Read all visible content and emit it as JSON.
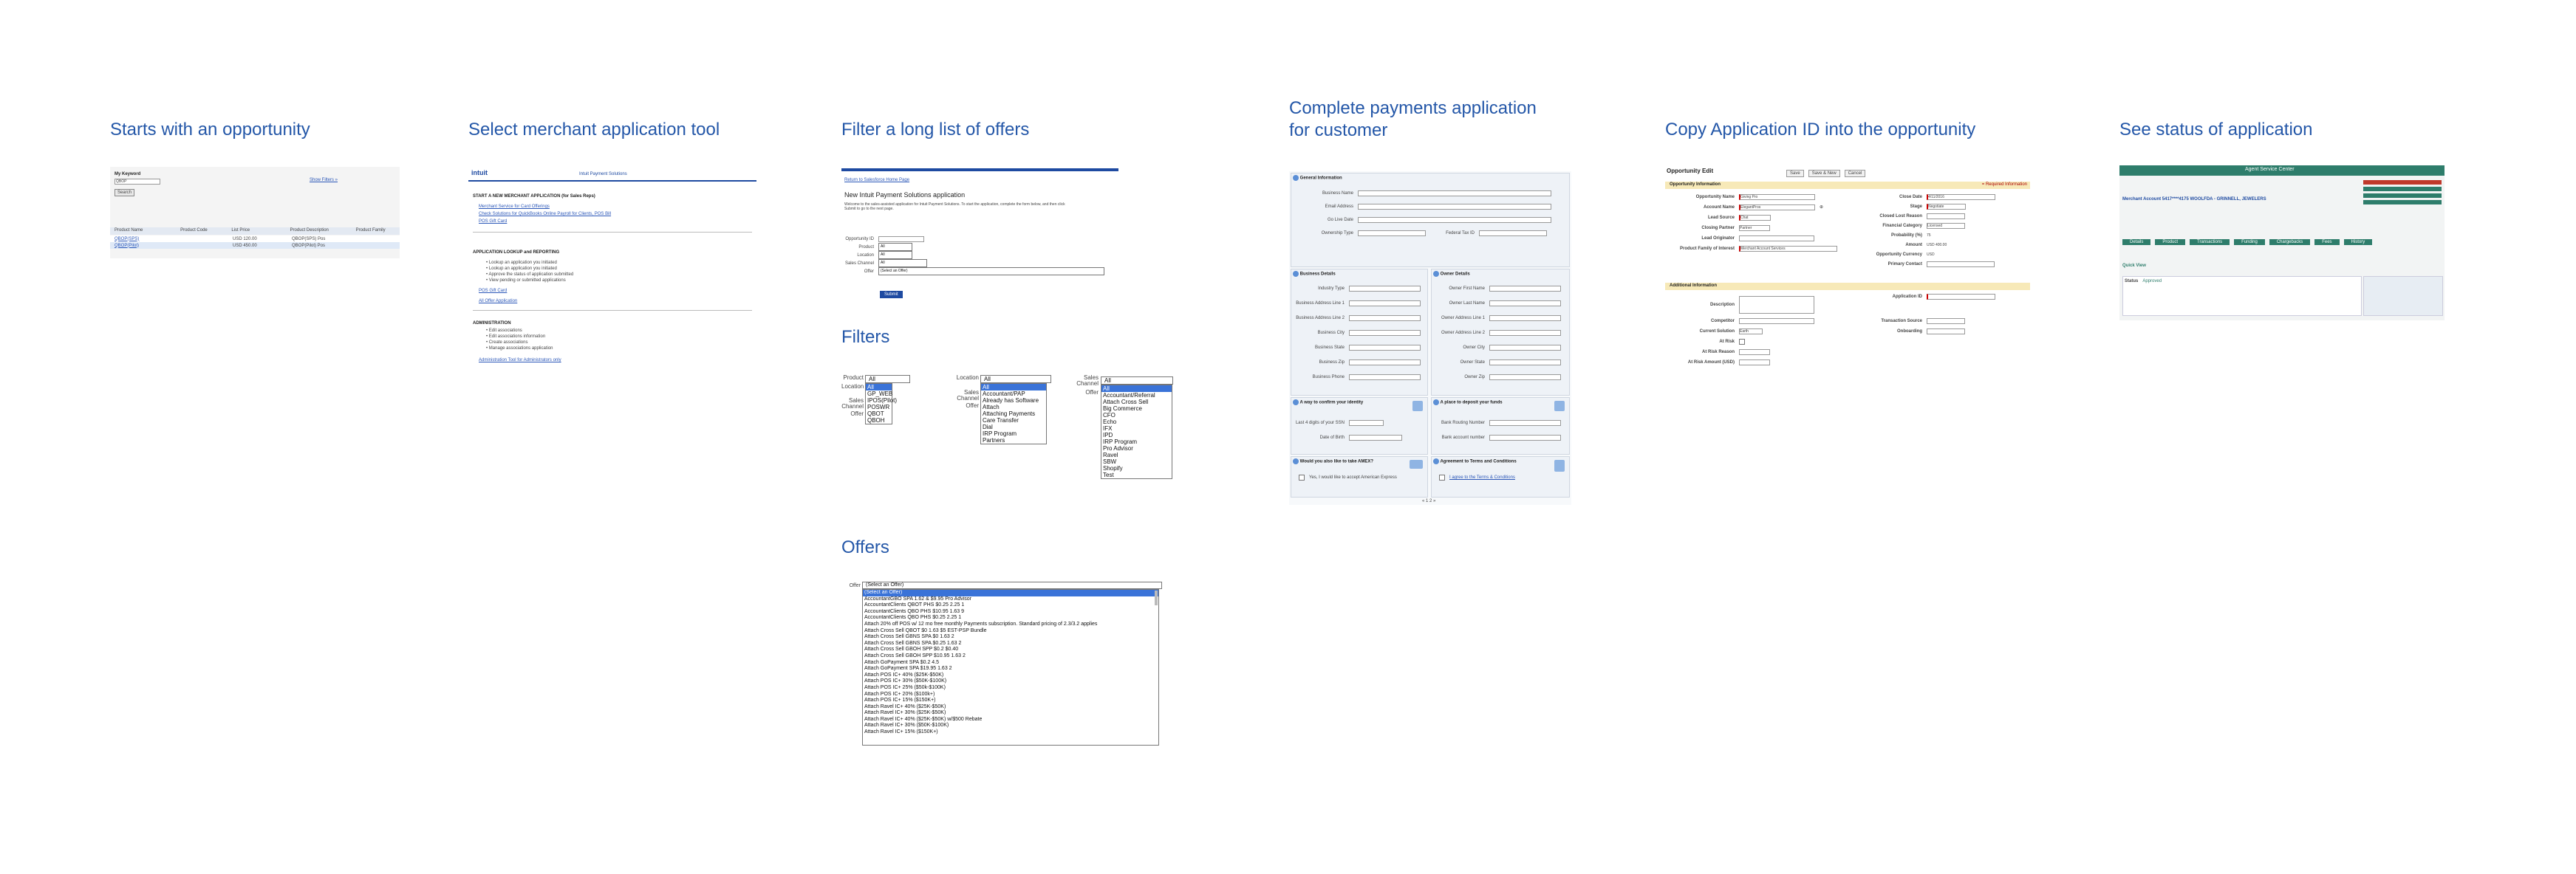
{
  "titles": {
    "t1": "Starts with an opportunity",
    "t2": "Select merchant application tool",
    "t3": "Filter a long list of offers",
    "t4_line1": "Complete payments application",
    "t4_line2": "for customer",
    "t5": "Copy Application ID into the opportunity",
    "t6": "See status of application",
    "filters": "Filters",
    "offers": "Offers"
  },
  "shot1": {
    "keyword_label": "My Keyword",
    "keyword_value": "QBOP",
    "search_btn": "Search",
    "advanced": "Show Filters »",
    "table_headers": [
      "Product Name",
      "Product Code",
      "List Price",
      "Product Description",
      "Product Family"
    ],
    "rows": [
      [
        "QBOP(SPS)",
        "",
        "USD 120.00",
        "QBOP(SPS) Pos",
        ""
      ],
      [
        "QBOP(Pilot)",
        "",
        "USD 450.00",
        "QBOP(Pilot) Pos",
        ""
      ]
    ]
  },
  "shot2": {
    "logo": "intuit",
    "brand": "Intuit Payment Solutions",
    "sec1": "START A NEW MERCHANT APPLICATION (for Sales Reps)",
    "links1": [
      "Merchant Service for Card Offerings",
      "Check Solutions for QuickBooks Online Payroll for Clients, POS Bill",
      "POS Gift Card"
    ],
    "sec2": "APPLICATION LOOKUP and REPORTING",
    "bullets2": [
      "Lookup an application you initiated",
      "Lookup an application you initiated",
      "Approve the status of application submitted",
      "View pending or submitted applications"
    ],
    "links2": [
      "POS Gift Card",
      "All Offer Application"
    ],
    "sec3": "ADMINISTRATION",
    "bullets3": [
      "Edit associations",
      "Edit associations information",
      "Create associations",
      "Manage associations application"
    ],
    "link3": "Administration Tool for Administrators only"
  },
  "shot3": {
    "back": "Return to Salesforce Home Page",
    "heading": "New Intuit Payment Solutions application",
    "intro": "Welcome to the sales-assisted application for Intuit Payment Solutions. To start the application, complete the form below, and then click Submit to go to the next page.",
    "fields": [
      "Opportunity ID",
      "Product",
      "Location",
      "Sales Channel",
      "Offer"
    ],
    "values": [
      "",
      "All",
      "All",
      "All",
      "(Select an Offer)"
    ],
    "submit": "Submit"
  },
  "filters": {
    "product_label": "Product",
    "location_label": "Location",
    "sales_label": "Sales Channel",
    "offer_label": "Offer",
    "dropdown1": [
      "All",
      "All",
      "GP_WEB",
      "IPOS(Pilot)",
      "POSWR",
      "QBOT",
      "QBOH"
    ],
    "dropdown2": [
      "All",
      "All",
      "Accountant/PAP",
      "Already has Software",
      "Attach",
      "Attaching Payments",
      "Care Transfer",
      "Dial",
      "IRP Program",
      "Partners"
    ],
    "dropdown3": [
      "All",
      "All",
      "Accountant/Referral",
      "Attach Cross Sell",
      "Big Commerce",
      "CFO",
      "Echo",
      "IFX",
      "IPD",
      "IRP Program",
      "Pro Advisor",
      "Ravel",
      "SBW",
      "Shopify",
      "Test"
    ]
  },
  "offers": {
    "label": "Offer",
    "selected": "(Select an Offer)",
    "items": [
      "(Select an Offer)",
      "AccountantGBO SPA 1.62 & $9.95 Pro Advisor",
      "AccountantClients QBOT PHS $0.25 2.25 1",
      "AccountantClients QBO PHS $10.95 1.63 9",
      "AccountantClients QBO PHS $0.25 2.25 1",
      "Attach 20% off POS w/ 12 mo free monthly Payments subscription. Standard pricing of 2.3/3.2 applies",
      "Attach Cross Sell QBOT $0 1.63 $5 EST-PSP Bundle",
      "Attach Cross Sell GBNS SPA $0 1.63 2",
      "Attach Cross Sell GBNS SPA $0.25 1.63 2",
      "Attach Cross Sell GBOH SPP $0.2 $0.40",
      "Attach Cross Sell GBOH SPP $10.95 1.63 2",
      "Attach GoPayment SPA $0.2 4.5",
      "Attach GoPayment SPA $19.95 1.63 2",
      "Attach POS IC+ 40% ($25K-$50K)",
      "Attach POS IC+ 30% ($50K-$100K)",
      "Attach POS IC+ 25% ($50k-$100K)",
      "Attach POS IC+ 20% ($100k+)",
      "Attach POS IC+ 15% ($150K+)",
      "Attach Ravel IC+ 40% ($25K-$50K)",
      "Attach Ravel IC+ 30% ($25K-$50K)",
      "Attach Ravel IC+ 40% ($25K-$50K) w/$500 Rebate",
      "Attach Ravel IC+ 30% ($50K-$100K)",
      "Attach Ravel IC+ 15% ($150K+)"
    ]
  },
  "shot4": {
    "general": "General Information",
    "business": "Business Details",
    "owner": "Owner Details",
    "confirm": "A way to confirm your identity",
    "deposit": "A place to deposit your funds",
    "amex": "Would you also like to take AMEX?",
    "terms": "Agreement to Terms and Conditions",
    "terms_link": "I agree to the Terms & Conditions",
    "amex_text": "Yes, I would like to accept American Express",
    "general_fields": [
      "Business Name",
      "Email Address",
      "Go Live Date",
      "Ownership Type",
      "Federal Tax ID"
    ],
    "business_fields": [
      "Industry Type",
      "Business Address Line 1",
      "Business Address Line 2",
      "Business City",
      "Business State",
      "Business Zip",
      "Business Phone"
    ],
    "owner_fields": [
      "Owner First Name",
      "Owner Last Name",
      "Owner Address Line 1",
      "Owner Address Line 2",
      "Owner City",
      "Owner State",
      "Owner Zip"
    ],
    "identity_fields": [
      "Last 4 digits of your SSN",
      "Date of Birth"
    ],
    "bank_fields": [
      "Bank Routing Number",
      "Bank account number"
    ],
    "pager": "« 1 2 »"
  },
  "shot5": {
    "title": "Opportunity Edit",
    "buttons": [
      "Save",
      "Save & New",
      "Cancel"
    ],
    "section1": "Opportunity Information",
    "section2": "Additional Information",
    "left_labels": [
      "Opportunity Name",
      "Account Name",
      "Lead Source",
      "Closing Partner",
      "Lead Originator",
      "Product Family of Interest"
    ],
    "left_values": [
      "Giving Pro",
      "ElegantPros",
      "Chat",
      "Partner",
      "",
      "Merchant Account Services"
    ],
    "right_labels": [
      "Close Date",
      "Stage",
      "Closed Lost Reason",
      "Financial Category",
      "Probability (%)",
      "Amount",
      "Opportunity Currency",
      "Primary Contact"
    ],
    "right_values": [
      "4/11/2016",
      "Negotiate",
      "",
      "Licensed",
      "75",
      "USD 400.00",
      "USD",
      ""
    ],
    "add_labels": [
      "Description",
      "Competitor",
      "Current Solution",
      "At Risk",
      "At Risk Reason",
      "At Risk Amount (USD)"
    ],
    "add_right_labels": [
      "Application ID",
      "Transaction Source",
      "Onboarding"
    ],
    "add_values": [
      "",
      "",
      "Earth",
      "",
      "",
      ""
    ],
    "required": "= Required Information"
  },
  "shot6": {
    "app_name": "Agent Service Center",
    "merchant": "Merchant Account 5417****4175 WOOLFDA - GRINNELL, JEWELERS",
    "tabs": [
      "Details",
      "Product",
      "Transactions",
      "Funding",
      "Chargebacks",
      "Fees",
      "History"
    ],
    "section": "Quick View",
    "status_label": "Status",
    "status_value": "Approved"
  },
  "colors": {
    "title": "#2457a8",
    "intuit_blue": "#1e4aa1",
    "asc_green": "#2e7d6b",
    "yellow_section": "#f7e9b8"
  }
}
